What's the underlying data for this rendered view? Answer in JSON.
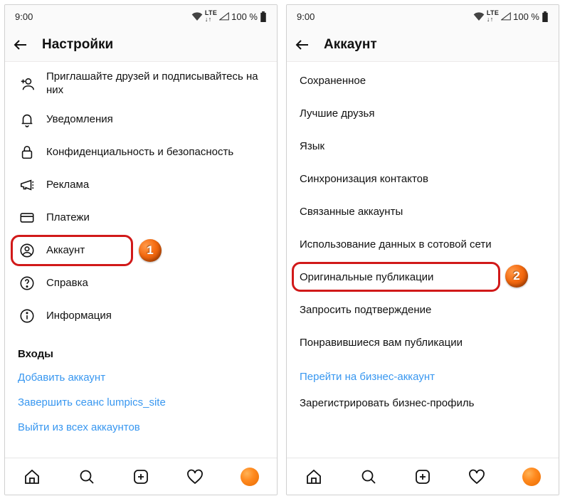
{
  "status": {
    "time": "9:00",
    "net": "LTE",
    "battery": "100 %"
  },
  "left": {
    "title": "Настройки",
    "rows": [
      {
        "icon": "user-plus",
        "label": "Приглашайте друзей и подписывайтесь на них"
      },
      {
        "icon": "bell",
        "label": "Уведомления"
      },
      {
        "icon": "lock",
        "label": "Конфиденциальность и безопасность"
      },
      {
        "icon": "megaphone",
        "label": "Реклама"
      },
      {
        "icon": "card",
        "label": "Платежи"
      },
      {
        "icon": "person",
        "label": "Аккаунт"
      },
      {
        "icon": "help",
        "label": "Справка"
      },
      {
        "icon": "info",
        "label": "Информация"
      }
    ],
    "section": "Входы",
    "links": [
      "Добавить аккаунт",
      "Завершить сеанс lumpics_site",
      "Выйти из всех аккаунтов"
    ]
  },
  "right": {
    "title": "Аккаунт",
    "rows": [
      "Сохраненное",
      "Лучшие друзья",
      "Язык",
      "Синхронизация контактов",
      "Связанные аккаунты",
      "Использование данных в сотовой сети",
      "Оригинальные публикации",
      "Запросить подтверждение",
      "Понравившиеся вам публикации"
    ],
    "link": "Перейти на бизнес-аккаунт",
    "last": "Зарегистрировать бизнес-профиль"
  },
  "badges": {
    "one": "1",
    "two": "2"
  }
}
